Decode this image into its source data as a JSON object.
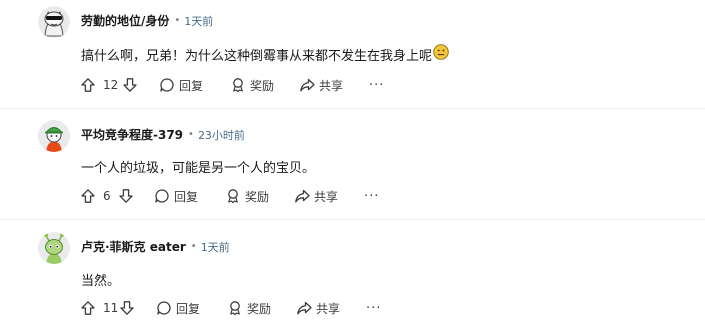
{
  "comments": [
    {
      "author": "劳勤的地位/身份",
      "separator": "•",
      "time": "1天前",
      "text": "搞什么啊，兄弟！为什么这种倒霉事从来都不发生在我身上呢",
      "emoji": "neutral-face",
      "votes": "12",
      "reply_label": "回复",
      "award_label": "奖励",
      "share_label": "共享",
      "more_label": "···",
      "avatar": "sunglasses-cat-avatar"
    },
    {
      "author": "平均竞争程度-379",
      "separator": "•",
      "time": "23小时前",
      "text": "一个人的垃圾，可能是另一个人的宝贝。",
      "votes": "6",
      "reply_label": "回复",
      "award_label": "奖励",
      "share_label": "共享",
      "more_label": "···",
      "avatar": "green-cap-avatar"
    },
    {
      "author": "卢克·菲斯克 eater",
      "separator": "•",
      "time": "1天前",
      "text": "当然。",
      "votes": "11",
      "reply_label": "回复",
      "award_label": "奖励",
      "share_label": "共享",
      "more_label": "···",
      "avatar": "green-alien-avatar"
    }
  ],
  "colors": {
    "time": "#4a6b8a",
    "text": "#1a1a1b",
    "icon": "#3c3c3c",
    "emoji_face": "#f5c53a"
  }
}
